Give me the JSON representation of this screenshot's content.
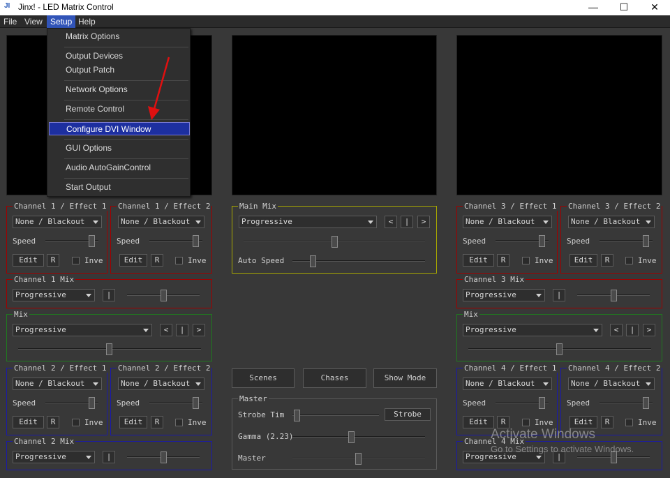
{
  "window": {
    "title": "Jinx! - LED Matrix Control",
    "logo": "JI",
    "minimize": "—",
    "maximize": "☐",
    "close": "✕"
  },
  "menubar": {
    "items": [
      "File",
      "View",
      "Setup",
      "Help"
    ],
    "active": "Setup"
  },
  "setup_menu": {
    "items": [
      "Matrix Options",
      "Output Devices",
      "Output Patch",
      "Network Options",
      "Remote Control",
      "Configure DVI Window",
      "GUI Options",
      "Audio AutoGainControl",
      "Start Output"
    ],
    "selected": "Configure DVI Window"
  },
  "left": {
    "ch1_fx1": {
      "title": "Channel 1 / Effect 1",
      "combo": "None / Blackout",
      "speed": "Speed",
      "edit": "Edit",
      "r": "R",
      "invert": "Inver"
    },
    "ch1_fx2": {
      "title": "Channel 1 / Effect 2",
      "combo": "None / Blackout",
      "speed": "Speed",
      "edit": "Edit",
      "r": "R",
      "invert": "Inver"
    },
    "ch1_mix": {
      "title": "Channel 1 Mix",
      "combo": "Progressive",
      "btn": "|"
    },
    "mix": {
      "title": "Mix",
      "combo": "Progressive",
      "prev": "<",
      "mid": "|",
      "next": ">"
    },
    "ch2_fx1": {
      "title": "Channel 2 / Effect 1",
      "combo": "None / Blackout",
      "speed": "Speed",
      "edit": "Edit",
      "r": "R",
      "invert": "Inver"
    },
    "ch2_fx2": {
      "title": "Channel 2 / Effect 2",
      "combo": "None / Blackout",
      "speed": "Speed",
      "edit": "Edit",
      "r": "R",
      "invert": "Inver"
    },
    "ch2_mix": {
      "title": "Channel 2 Mix",
      "combo": "Progressive",
      "btn": "|"
    }
  },
  "center": {
    "main_mix": {
      "title": "Main Mix",
      "combo": "Progressive",
      "prev": "<",
      "mid": "|",
      "next": ">",
      "auto_speed": "Auto Speed"
    },
    "scenes": "Scenes",
    "chases": "Chases",
    "show_mode": "Show Mode",
    "master": {
      "title": "Master",
      "strobe_time": "Strobe Tim",
      "strobe": "Strobe",
      "gamma": "Gamma (2.23)",
      "master": "Master"
    }
  },
  "right": {
    "ch3_fx1": {
      "title": "Channel 3 / Effect 1",
      "combo": "None / Blackout",
      "speed": "Speed",
      "edit": "Edit",
      "r": "R",
      "invert": "Inver"
    },
    "ch3_fx2": {
      "title": "Channel 3 / Effect 2",
      "combo": "None / Blackout",
      "speed": "Speed",
      "edit": "Edit",
      "r": "R",
      "invert": "Inver"
    },
    "ch3_mix": {
      "title": "Channel 3 Mix",
      "combo": "Progressive",
      "btn": "|"
    },
    "mix": {
      "title": "Mix",
      "combo": "Progressive",
      "prev": "<",
      "mid": "|",
      "next": ">"
    },
    "ch4_fx1": {
      "title": "Channel 4 / Effect 1",
      "combo": "None / Blackout",
      "speed": "Speed",
      "edit": "Edit",
      "r": "R",
      "invert": "Inver"
    },
    "ch4_fx2": {
      "title": "Channel 4 / Effect 2",
      "combo": "None / Blackout",
      "speed": "Speed",
      "edit": "Edit",
      "r": "R",
      "invert": "Inver"
    },
    "ch4_mix": {
      "title": "Channel 4 Mix",
      "combo": "Progressive",
      "btn": "|"
    }
  },
  "watermark": {
    "line1": "Activate Windows",
    "line2": "Go to Settings to activate Windows."
  },
  "colors": {
    "effect_border": "#a00000",
    "mix_border": "#1f7a1f",
    "channel_mix_border": "#1a1aa8",
    "main_mix_border": "#a8a800",
    "menu_selected": "#1d2fa0",
    "annotation_arrow": "#e01010"
  }
}
